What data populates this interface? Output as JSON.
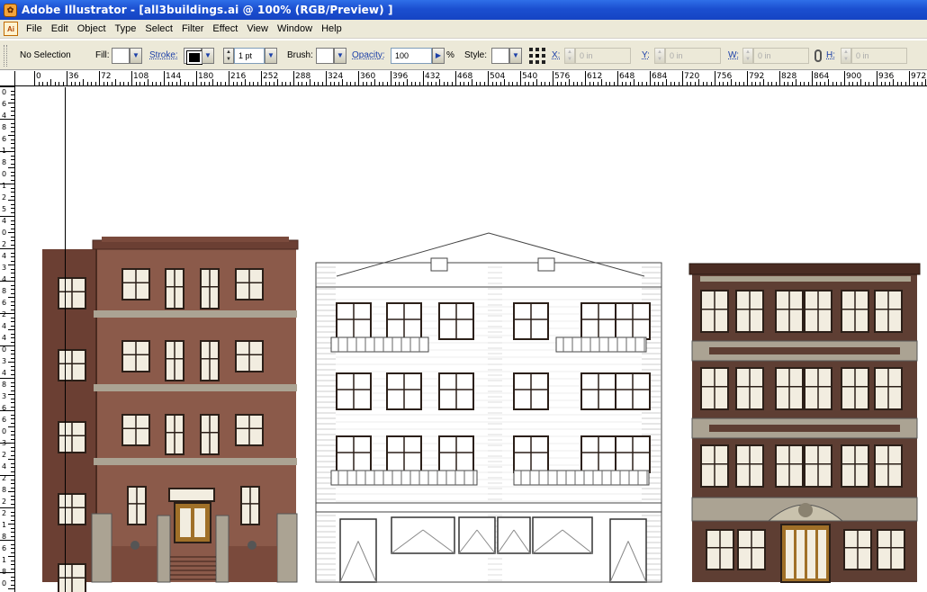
{
  "window": {
    "title": "Adobe Illustrator - [all3buildings.ai @ 100% (RGB/Preview) ]",
    "app_icon": "illustrator-app-icon"
  },
  "menu": {
    "doc_icon": "illustrator-document-icon",
    "items": [
      "File",
      "Edit",
      "Object",
      "Type",
      "Select",
      "Filter",
      "Effect",
      "View",
      "Window",
      "Help"
    ]
  },
  "control": {
    "selection": "No Selection",
    "fill_label": "Fill:",
    "stroke_label": "Stroke:",
    "stroke_weight": "1 pt",
    "brush_label": "Brush:",
    "opacity_label": "Opacity:",
    "opacity_value": "100",
    "opacity_unit": "%",
    "style_label": "Style:",
    "x_label": "X:",
    "x_value": "0 in",
    "y_label": "Y:",
    "y_value": "0 in",
    "w_label": "W:",
    "w_value": "0 in",
    "h_label": "H:",
    "h_value": "0 in"
  },
  "ruler": {
    "h_labels": [
      "0",
      "36",
      "72",
      "108",
      "144",
      "180",
      "216",
      "252",
      "288",
      "324",
      "360",
      "396",
      "432",
      "468",
      "504",
      "540",
      "576",
      "612",
      "648",
      "684",
      "720",
      "756",
      "792",
      "828",
      "864",
      "900",
      "936",
      "972"
    ],
    "v_labels": [
      "0",
      "6",
      "4",
      "8",
      "6",
      "1",
      "8",
      "0",
      "1",
      "2",
      "5",
      "4",
      "0",
      "2",
      "4",
      "3",
      "4",
      "8",
      "6",
      "2",
      "4",
      "4",
      "0",
      "3",
      "4",
      "8",
      "3",
      "6",
      "6",
      "0",
      "3",
      "2",
      "4",
      "2",
      "8",
      "2",
      "2",
      "1",
      "8",
      "6",
      "1",
      "8",
      "0"
    ]
  },
  "colors": {
    "brick": "#8b5a4a",
    "brick_dark": "#6b3f33",
    "stone": "#aba393",
    "window_glass": "#f2ede0",
    "door_wood": "#a07028"
  }
}
